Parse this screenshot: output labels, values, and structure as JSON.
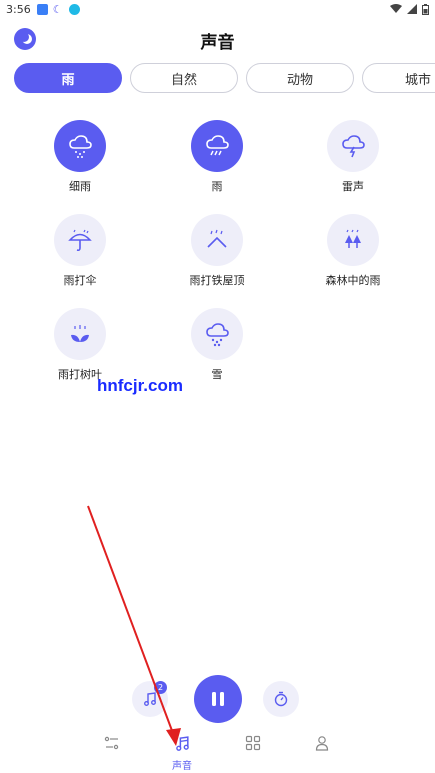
{
  "status_bar": {
    "time": "3:56"
  },
  "header": {
    "title": "声音"
  },
  "tabs": [
    {
      "label": "雨",
      "active": true
    },
    {
      "label": "自然",
      "active": false
    },
    {
      "label": "动物",
      "active": false
    },
    {
      "label": "城市",
      "active": false
    }
  ],
  "sounds": [
    {
      "label": "细雨",
      "icon": "drizzle-cloud-icon",
      "active": true
    },
    {
      "label": "雨",
      "icon": "rain-cloud-icon",
      "active": true
    },
    {
      "label": "雷声",
      "icon": "thunder-cloud-icon",
      "active": false
    },
    {
      "label": "雨打伞",
      "icon": "umbrella-rain-icon",
      "active": false
    },
    {
      "label": "雨打铁屋顶",
      "icon": "rain-roof-icon",
      "active": false
    },
    {
      "label": "森林中的雨",
      "icon": "forest-rain-icon",
      "active": false
    },
    {
      "label": "雨打树叶",
      "icon": "rain-leaf-icon",
      "active": false
    },
    {
      "label": "雪",
      "icon": "snow-cloud-icon",
      "active": false
    }
  ],
  "watermark": "hnfcjr.com",
  "player": {
    "badge": "2"
  },
  "bottom_nav": {
    "sound_label": "声音"
  },
  "colors": {
    "accent": "#5a5cf0",
    "icon_bg": "#eeeef9",
    "annotation": "#e02020"
  }
}
